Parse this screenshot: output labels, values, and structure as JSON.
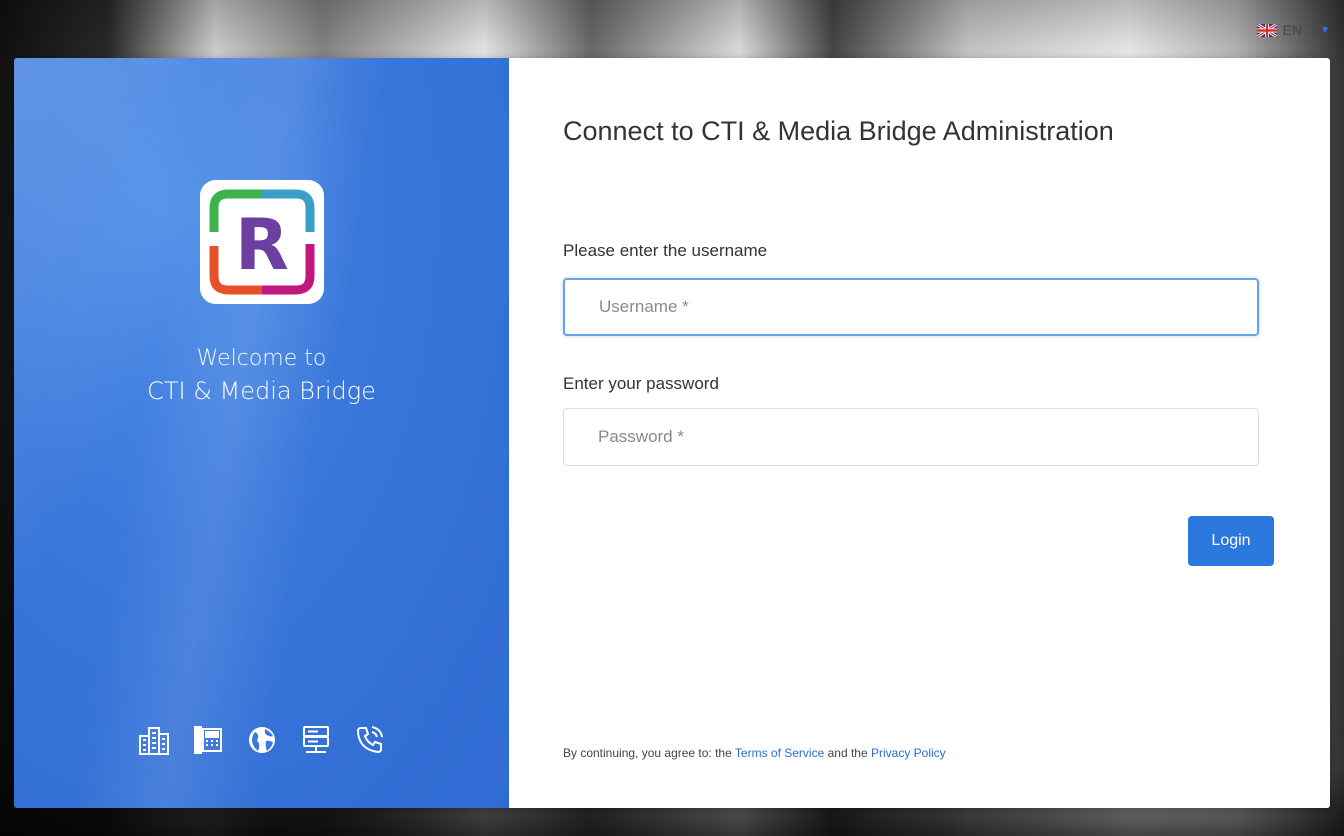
{
  "language": {
    "code": "EN",
    "flag_icon": "uk-flag-icon",
    "caret_icon": "caret-down-icon"
  },
  "left_panel": {
    "logo_letter": "R",
    "welcome_line1": "Welcome to",
    "welcome_line2": "CTI & Media Bridge",
    "feature_icons": [
      "buildings-icon",
      "desk-phone-icon",
      "globe-icon",
      "server-icon",
      "phone-call-icon"
    ],
    "color": "#3a78dc"
  },
  "form": {
    "title": "Connect to CTI & Media Bridge Administration",
    "username_label": "Please enter the username",
    "username_placeholder": "Username *",
    "username_value": "",
    "password_label": "Enter your password",
    "password_placeholder": "Password *",
    "password_value": "",
    "login_label": "Login",
    "accent": "#2b78de"
  },
  "legal": {
    "prefix": "By continuing, you agree to: the",
    "terms": "Terms of Service",
    "middle": "and the",
    "privacy": "Privacy Policy"
  }
}
